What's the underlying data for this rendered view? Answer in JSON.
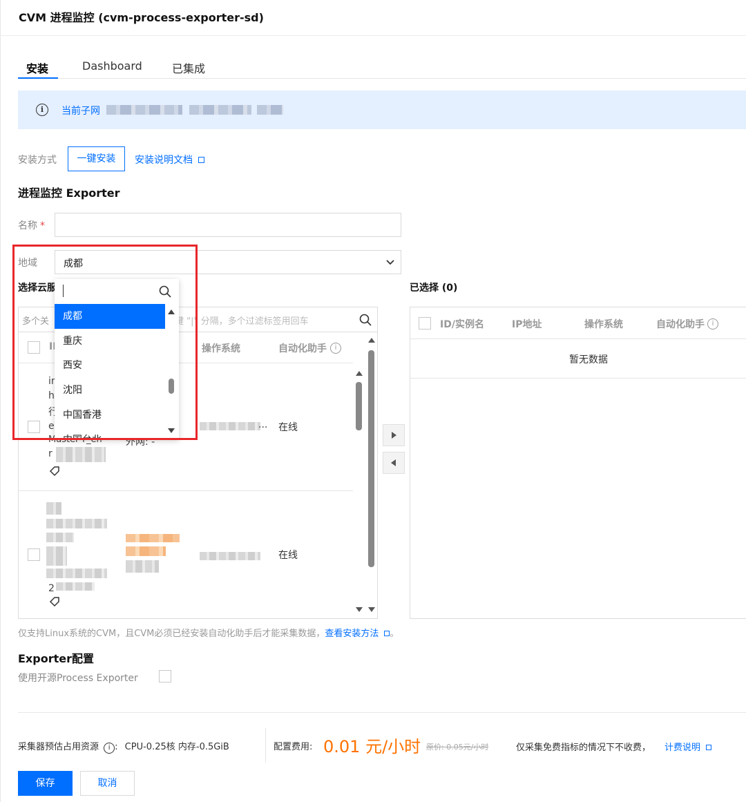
{
  "header": {
    "title": "CVM 进程监控 (cvm-process-exporter-sd)"
  },
  "tabs": [
    {
      "label": "安装",
      "active": true
    },
    {
      "label": "Dashboard",
      "active": false
    },
    {
      "label": "已集成",
      "active": false
    }
  ],
  "notice": {
    "label": "当前子网"
  },
  "install": {
    "method_label": "安装方式",
    "one_click": "一键安装",
    "doc_link": "安装说明文档"
  },
  "exporter": {
    "title": "进程监控 Exporter",
    "name_label": "名称",
    "required_mark": "*",
    "region_label": "地域",
    "region_value": "成都"
  },
  "select_cvm": {
    "title": "选择云服",
    "search_placeholder": "多个关",
    "search_placeholder_tail": "键 \"|\" 分隔，多个过滤标签用回车",
    "col_id": "ID",
    "col_os": "操作系统",
    "col_agent": "自动化助手",
    "row1": {
      "id_frag": [
        "in",
        "h",
        "行",
        "e",
        "Master-T_eh",
        "r"
      ],
      "net": "外网: -",
      "status": "在线"
    },
    "row2": {
      "id_frag": "2",
      "status": "在线"
    }
  },
  "dropdown": {
    "items": [
      "成都",
      "重庆",
      "西安",
      "沈阳",
      "中国香港",
      "中国台北"
    ],
    "selected": "成都"
  },
  "selected_panel": {
    "title": "已选择 (0)",
    "col_id": "ID/实例名",
    "col_ip": "IP地址",
    "col_os": "操作系统",
    "col_agent": "自动化助手",
    "empty": "暂无数据"
  },
  "hint": {
    "text": "仅支持Linux系统的CVM，且CVM必须已经安装自动化助手后才能采集数据，",
    "link": "查看安装方法",
    "tail": "。"
  },
  "exporter_config": {
    "title": "Exporter配置",
    "opensource_label": "使用开源Process Exporter"
  },
  "footer": {
    "resource_label": "采集器预估占用资源",
    "resource_value": "CPU-0.25核 内存-0.5GiB",
    "fee_label": "配置费用:",
    "fee_value": "0.01 元/小时",
    "original_price": "原价: 0.05元/小时",
    "free_note": "仅采集免费指标的情况下不收费，",
    "billing_link": "计费说明",
    "save": "保存",
    "cancel": "取消"
  },
  "colors": {
    "accent": "#006eff",
    "highlight": "#e8262a",
    "price": "#ff7200"
  }
}
